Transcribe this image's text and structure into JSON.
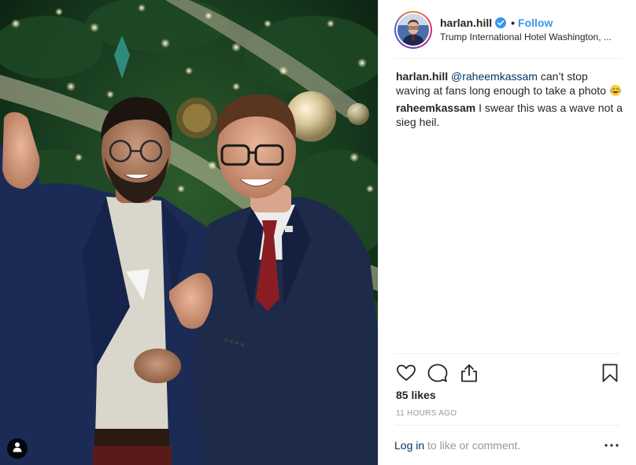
{
  "post": {
    "username": "harlan.hill",
    "follow_label": "Follow",
    "separator": "•",
    "location": "Trump International Hotel Washington, ...",
    "verified": true
  },
  "comments": [
    {
      "user": "harlan.hill",
      "mention": "@raheemkassam",
      "text": " can’t stop waving at fans long enough to take a photo",
      "emoji": "tears-of-joy-emoji"
    },
    {
      "user": "raheemkassam",
      "text": " I swear this was a wave not a sieg heil."
    }
  ],
  "likes_label": "85 likes",
  "time_label": "11 HOURS AGO",
  "login": {
    "link": "Log in",
    "rest": " to like or comment."
  },
  "icons": {
    "like": "heart-icon",
    "comment": "comment-icon",
    "share": "share-icon",
    "save": "bookmark-icon",
    "more": "more-options-icon",
    "tag": "user-tag-icon"
  },
  "colors": {
    "accent": "#3897f0",
    "link": "#003569",
    "muted": "#999999",
    "text": "#262626"
  }
}
